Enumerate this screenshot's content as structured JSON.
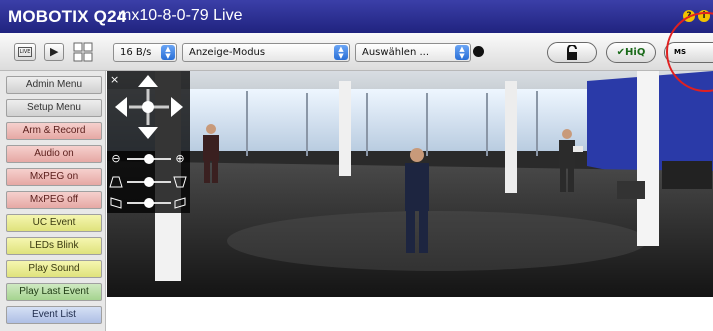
{
  "titlebar": {
    "app_name": "MOBOTIX Q24",
    "camera_label": "mx10-8-0-79 Live",
    "help_glyph": "?",
    "info_glyph": "i"
  },
  "toolbar": {
    "live_label": "LIVE",
    "play_glyph": "▶",
    "grid_glyph": "⊞",
    "framerate_select": "16 B/s",
    "mode_select": "Anzeige-Modus",
    "choose_select": "Auswählen ...",
    "lock_glyph": "🔓",
    "hiq_label": "✔HiQ",
    "ms_label": "MS"
  },
  "sidebar": {
    "buttons": [
      {
        "label": "Admin Menu",
        "style": "gray"
      },
      {
        "label": "Setup Menu",
        "style": "gray"
      },
      {
        "label": "Arm & Record",
        "style": "red"
      },
      {
        "label": "Audio on",
        "style": "red"
      },
      {
        "label": "MxPEG on",
        "style": "red"
      },
      {
        "label": "MxPEG off",
        "style": "red"
      },
      {
        "label": "UC Event",
        "style": "yellow"
      },
      {
        "label": "LEDs Blink",
        "style": "yellow"
      },
      {
        "label": "Play Sound",
        "style": "yellow"
      },
      {
        "label": "Play Last Event",
        "style": "green"
      },
      {
        "label": "Event List",
        "style": "blue"
      }
    ]
  },
  "ptz": {
    "close_glyph": "×",
    "zoom_out": "⊖",
    "zoom_in": "⊕"
  },
  "colors": {
    "title_bg": "#2b2f96",
    "accent_circle": "#e02020"
  }
}
